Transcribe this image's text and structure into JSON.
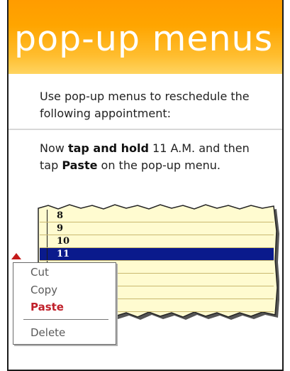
{
  "header": {
    "title": "pop-up menus"
  },
  "intro": {
    "text": "Use pop-up menus to reschedule the following appointment:"
  },
  "instruction": {
    "prefix": "Now ",
    "bold1": "tap and hold",
    "mid": " 11 A.M. and then tap ",
    "bold2": "Paste",
    "suffix": " on the pop-up menu."
  },
  "calendar": {
    "rows": [
      {
        "label": "8",
        "selected": false
      },
      {
        "label": "9",
        "selected": false
      },
      {
        "label": "10",
        "selected": false
      },
      {
        "label": "11",
        "selected": true
      },
      {
        "label": "",
        "selected": false
      },
      {
        "label": "",
        "selected": false
      },
      {
        "label": "",
        "selected": false
      },
      {
        "label": "",
        "selected": false
      }
    ]
  },
  "context_menu": {
    "items": [
      "Cut",
      "Copy",
      "Paste",
      "Delete"
    ],
    "highlight_color": "#c0202a"
  },
  "colors": {
    "banner": "#ffa500",
    "selection": "#0a1a8c",
    "note_paper": "#fffbd0"
  }
}
